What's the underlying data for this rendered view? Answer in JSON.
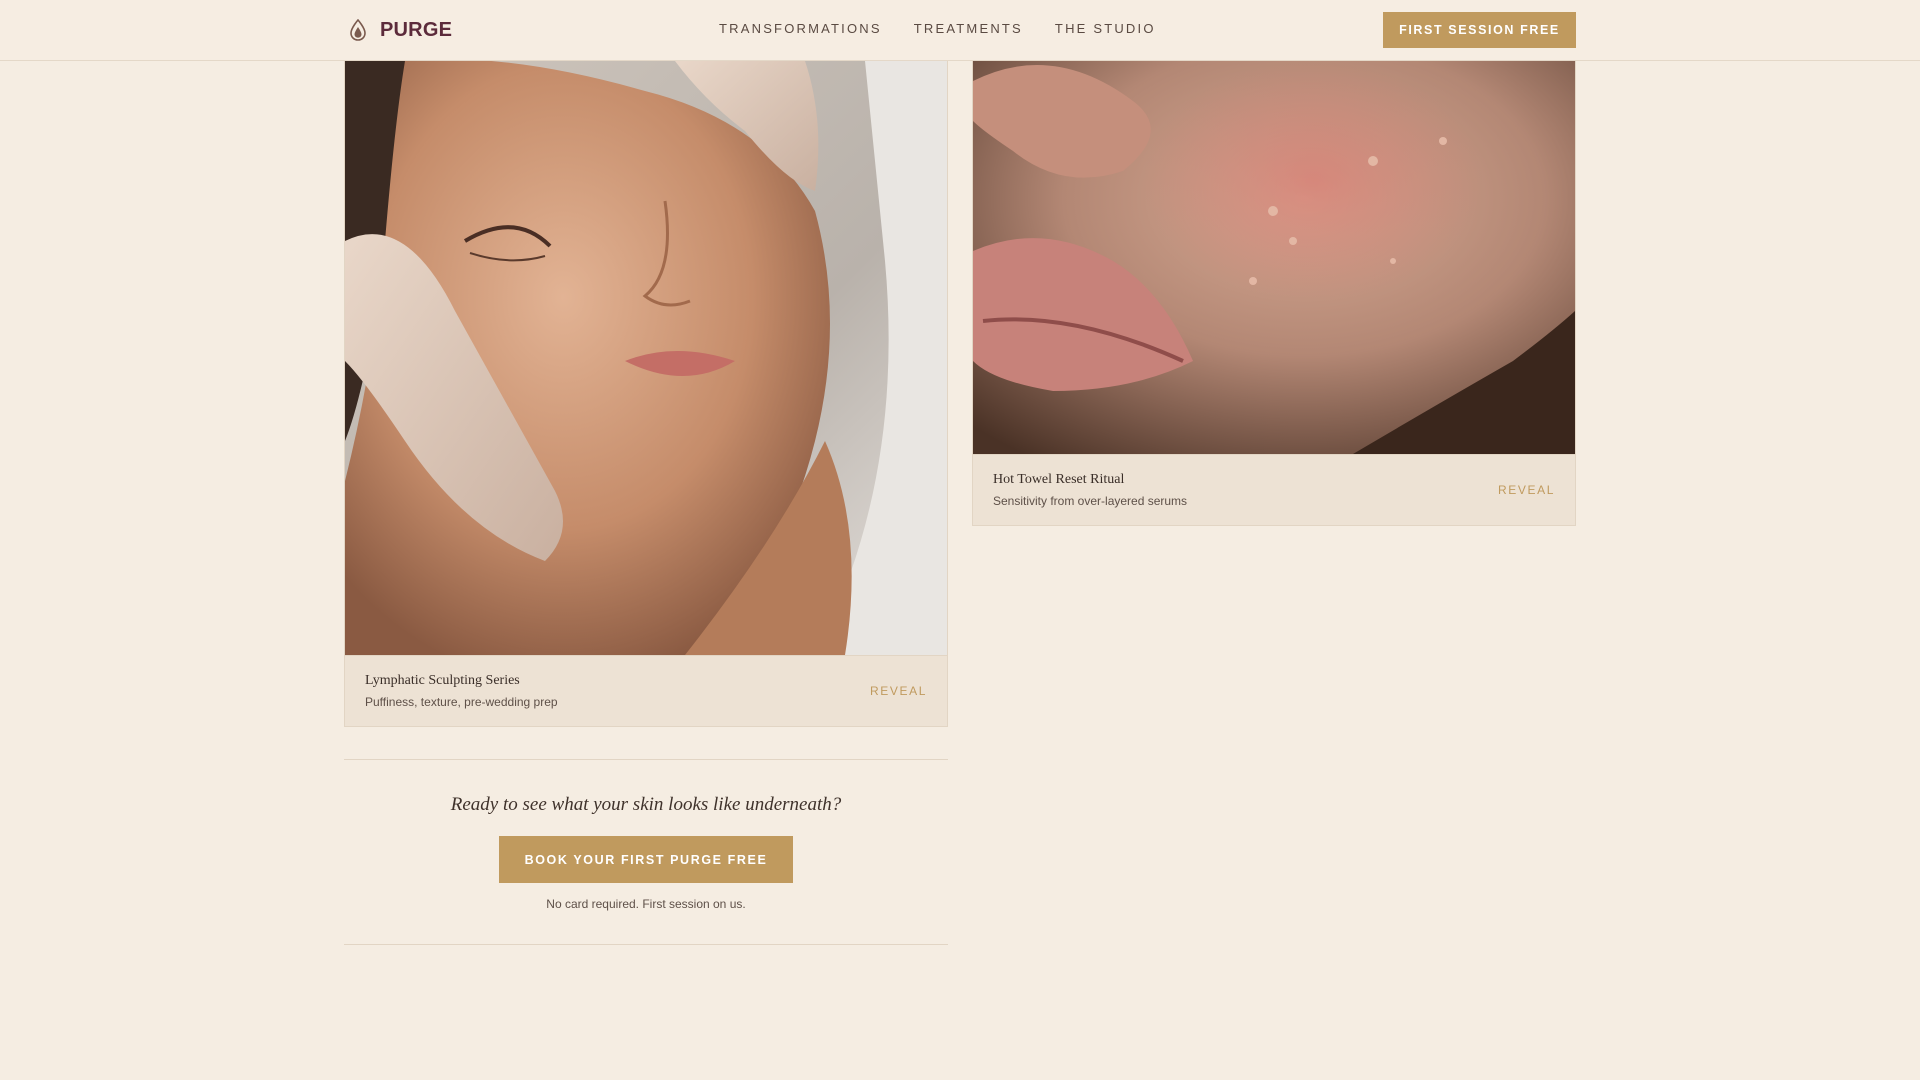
{
  "brand": {
    "name": "PURGE",
    "logo_icon": "flame-drop-icon",
    "primary_color": "#5c2b3b",
    "accent_color": "#c09a5e",
    "background_color": "#f5ede2"
  },
  "nav": {
    "items": [
      {
        "label": "TRANSFORMATIONS"
      },
      {
        "label": "TREATMENTS"
      },
      {
        "label": "THE STUDIO"
      }
    ],
    "cta_label": "FIRST SESSION FREE"
  },
  "cards": [
    {
      "image": "face-massage-photo",
      "title": "Lymphatic Sculpting Series",
      "subtitle": "Puffiness, texture, pre-wedding prep",
      "action": "REVEAL"
    },
    {
      "image": "skin-closeup-photo",
      "title": "Hot Towel Reset Ritual",
      "subtitle": "Sensitivity from over-layered serums",
      "action": "REVEAL"
    }
  ],
  "cta": {
    "question": "Ready to see what your skin looks like underneath?",
    "button_label": "BOOK YOUR FIRST PURGE FREE",
    "note": "No card required. First session on us."
  }
}
